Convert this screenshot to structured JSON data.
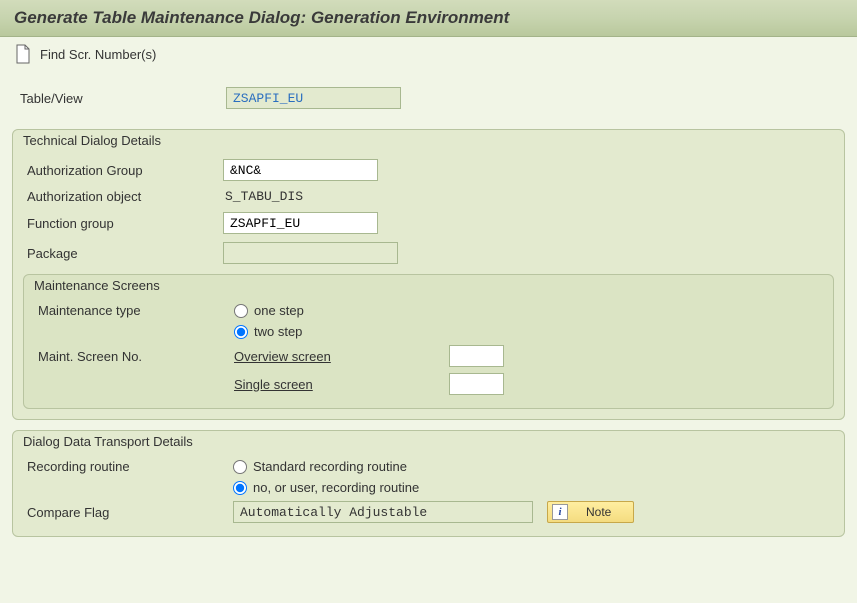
{
  "title": "Generate Table Maintenance Dialog: Generation Environment",
  "toolbar": {
    "find_scr_label": "Find Scr. Number(s)"
  },
  "top": {
    "table_view_label": "Table/View",
    "table_view_value": "ZSAPFI_EU"
  },
  "technical": {
    "legend": "Technical Dialog Details",
    "auth_group_label": "Authorization Group",
    "auth_group_value": "&NC&",
    "auth_object_label": "Authorization object",
    "auth_object_value": "S_TABU_DIS",
    "func_group_label": "Function group",
    "func_group_value": "ZSAPFI_EU",
    "package_label": "Package",
    "package_value": ""
  },
  "maint_screens": {
    "legend": "Maintenance Screens",
    "maint_type_label": "Maintenance type",
    "one_step_label": "one step",
    "two_step_label": "two step",
    "maint_screen_no_label": "Maint. Screen No.",
    "overview_label": "Overview screen",
    "overview_value": "",
    "single_label": "Single screen",
    "single_value": ""
  },
  "transport": {
    "legend": "Dialog Data Transport Details",
    "recording_label": "Recording routine",
    "standard_label": "Standard recording routine",
    "no_user_label": "no, or user, recording routine",
    "compare_flag_label": "Compare Flag",
    "compare_flag_value": "Automatically Adjustable",
    "note_label": "Note"
  }
}
